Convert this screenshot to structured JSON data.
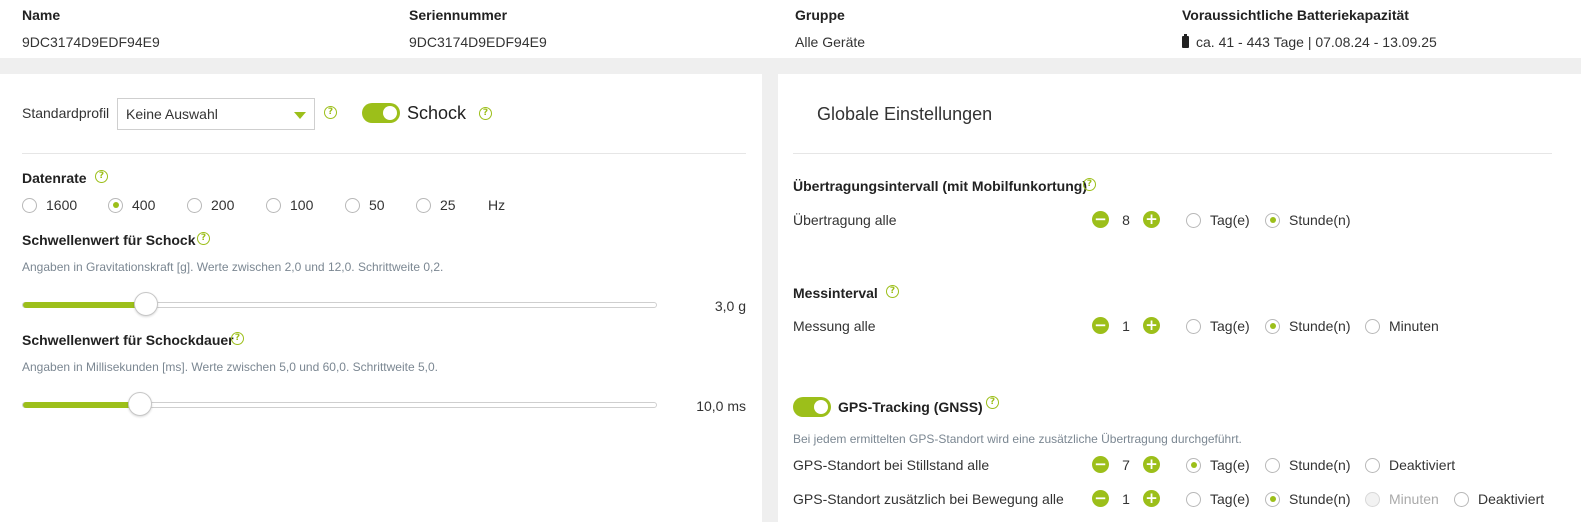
{
  "header": {
    "cols": [
      {
        "label": "Name",
        "value": "9DC3174D9EDF94E9"
      },
      {
        "label": "Seriennummer",
        "value": "9DC3174D9EDF94E9"
      },
      {
        "label": "Gruppe",
        "value": "Alle Geräte"
      },
      {
        "label": "Voraussichtliche Batteriekapazität",
        "value": "ca. 41 - 443 Tage | 07.08.24 - 13.09.25"
      }
    ]
  },
  "left": {
    "profile_label": "Standardprofil",
    "profile_value": "Keine Auswahl",
    "shock_toggle_label": "Schock",
    "datarate": {
      "label": "Datenrate",
      "options": [
        "1600",
        "400",
        "200",
        "100",
        "50",
        "25"
      ],
      "selected": "400",
      "unit": "Hz"
    },
    "shock_threshold": {
      "label": "Schwellenwert für Schock",
      "hint": "Angaben in Gravitationskraft [g]. Werte zwischen 2,0 und 12,0. Schrittweite 0,2.",
      "value": "3,0 g",
      "fraction": 0.1
    },
    "shock_duration": {
      "label": "Schwellenwert für Schockdauer",
      "hint": "Angaben in Millisekunden [ms]. Werte zwischen 5,0 und 60,0. Schrittweite 5,0.",
      "value": "10,0 ms",
      "fraction": 0.09
    }
  },
  "right": {
    "title": "Globale Einstellungen",
    "transmission": {
      "heading": "Übertragungsintervall (mit Mobilfunkortung)",
      "row_label": "Übertragung alle",
      "value": "8",
      "unit_day": "Tag(e)",
      "unit_hour": "Stunde(n)"
    },
    "measure": {
      "heading": "Messinterval",
      "row_label": "Messung alle",
      "value": "1",
      "unit_day": "Tag(e)",
      "unit_hour": "Stunde(n)",
      "unit_min": "Minuten"
    },
    "gps": {
      "heading": "GPS-Tracking (GNSS)",
      "hint": "Bei jedem ermittelten GPS-Standort wird eine zusätzliche Übertragung durchgeführt.",
      "still_label": "GPS-Standort bei Stillstand alle",
      "still_value": "7",
      "move_label": "GPS-Standort zusätzlich bei Bewegung alle",
      "move_value": "1",
      "unit_day": "Tag(e)",
      "unit_hour": "Stunde(n)",
      "unit_min": "Minuten",
      "unit_off": "Deaktiviert"
    }
  },
  "icons": {
    "help": "question-icon",
    "battery": "battery-icon",
    "minus": "−",
    "plus": "+"
  },
  "colors": {
    "accent": "#9cbf1a"
  }
}
